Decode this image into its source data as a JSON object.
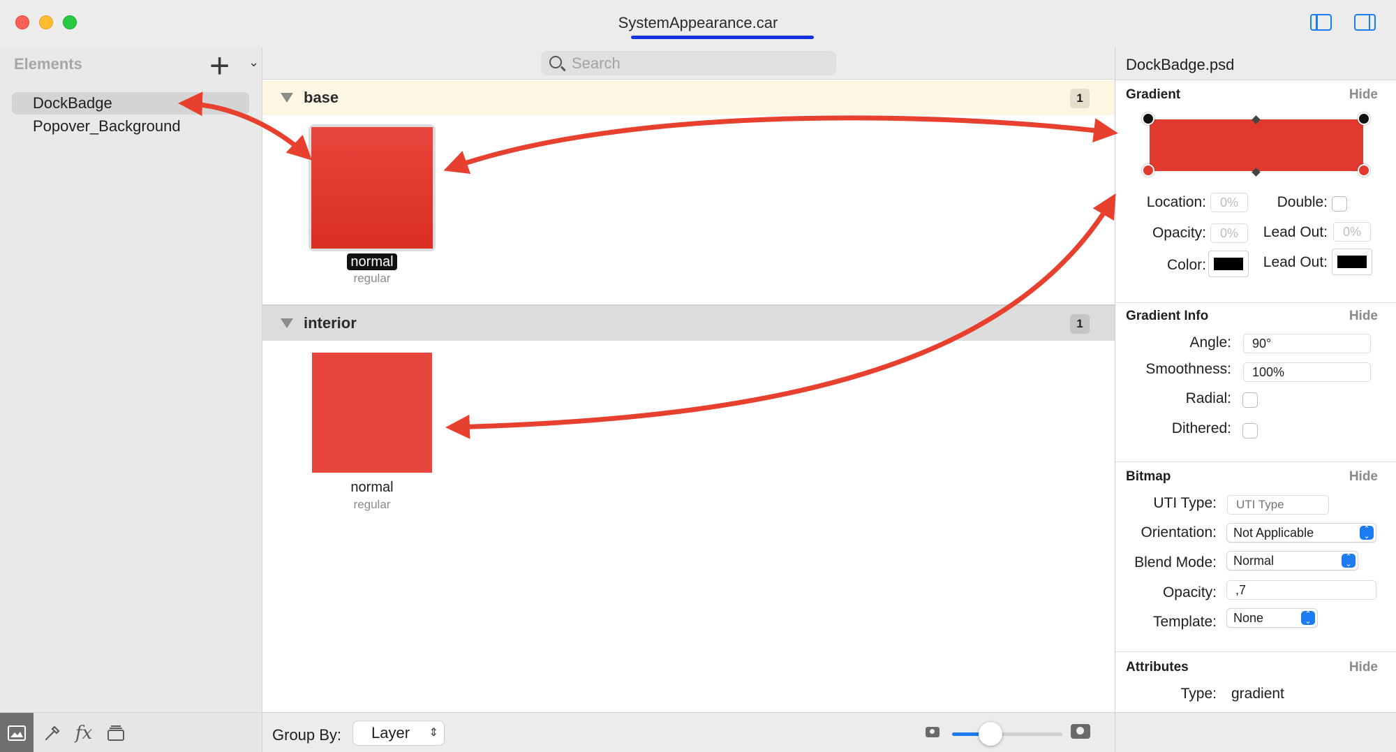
{
  "window": {
    "title": "SystemAppearance.car"
  },
  "sidebar": {
    "header": "Elements",
    "items": [
      {
        "label": "DockBadge"
      },
      {
        "label": "Popover_Background"
      }
    ]
  },
  "search": {
    "placeholder": "Search"
  },
  "groups": [
    {
      "title": "base",
      "count": "1",
      "cell": {
        "label": "normal",
        "sublabel": "regular"
      }
    },
    {
      "title": "interior",
      "count": "1",
      "cell": {
        "label": "normal",
        "sublabel": "regular"
      }
    }
  ],
  "footer": {
    "group_by_label": "Group By:",
    "group_by_value": "Layer",
    "thumbnail_size": 0.35
  },
  "inspector": {
    "file_name": "DockBadge.psd",
    "gradient": {
      "title": "Gradient",
      "hide": "Hide",
      "location_label": "Location:",
      "location_value": "0%",
      "double_label": "Double:",
      "opacity_label": "Opacity:",
      "opacity_value": "0%",
      "lead_out_label": "Lead Out:",
      "lead_out_value": "0%",
      "color_label": "Color:",
      "lead_out_color_label": "Lead Out:",
      "bar_color": "#e2392e"
    },
    "gradient_info": {
      "title": "Gradient Info",
      "hide": "Hide",
      "angle_label": "Angle:",
      "angle_value": "90°",
      "smoothness_label": "Smoothness:",
      "smoothness_value": "100%",
      "radial_label": "Radial:",
      "dithered_label": "Dithered:"
    },
    "bitmap": {
      "title": "Bitmap",
      "hide": "Hide",
      "uti_label": "UTI Type:",
      "uti_placeholder": "UTI Type",
      "orientation_label": "Orientation:",
      "orientation_value": "Not Applicable",
      "blend_label": "Blend Mode:",
      "blend_value": "Normal",
      "opacity_label": "Opacity:",
      "opacity_value": ",7",
      "template_label": "Template:",
      "template_value": "None"
    },
    "attributes": {
      "title": "Attributes",
      "hide": "Hide",
      "type_label": "Type:",
      "type_value": "gradient"
    }
  },
  "colors": {
    "accent": "#1d7bf2",
    "swatch_red": "#e8463d",
    "annotation_arrow": "#e8402e",
    "title_underline": "#1532e0"
  },
  "icons": [
    "add-icon",
    "search-icon",
    "toggle-left-sidebar-icon",
    "toggle-right-sidebar-icon",
    "image-icon",
    "eyedropper-icon",
    "fx-icon",
    "layers-icon",
    "camera-icon"
  ]
}
